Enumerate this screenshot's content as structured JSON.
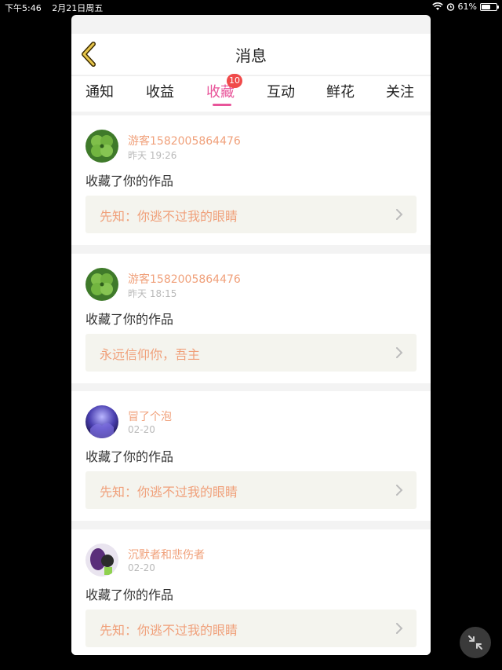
{
  "status_bar": {
    "time": "下午5:46",
    "date": "2月21日周五",
    "battery": "61%",
    "battery_level": 0.61,
    "wifi_icon": "wifi-icon",
    "alarm_icon": "alarm-icon"
  },
  "header": {
    "title": "消息",
    "back_icon": "chevron-left-icon"
  },
  "tabs": [
    {
      "label": "通知"
    },
    {
      "label": "收益"
    },
    {
      "label": "收藏",
      "badge": "10",
      "active": true
    },
    {
      "label": "互动"
    },
    {
      "label": "鲜花"
    },
    {
      "label": "关注"
    }
  ],
  "messages": [
    {
      "user": "游客1582005864476",
      "time": "昨天 19:26",
      "action": "收藏了你的作品",
      "work": "先知：你逃不过我的眼睛"
    },
    {
      "user": "游客1582005864476",
      "time": "昨天 18:15",
      "action": "收藏了你的作品",
      "work": "永远信仰你，吾主"
    },
    {
      "user": "冒了个泡",
      "time": "02-20",
      "action": "收藏了你的作品",
      "work": "先知：你逃不过我的眼睛"
    },
    {
      "user": "沉默者和悲伤者",
      "time": "02-20",
      "action": "收藏了你的作品",
      "work": "先知：你逃不过我的眼睛"
    }
  ],
  "colors": {
    "accent": "#e8559a",
    "name": "#f0a07a",
    "badge": "#f04a4a"
  }
}
